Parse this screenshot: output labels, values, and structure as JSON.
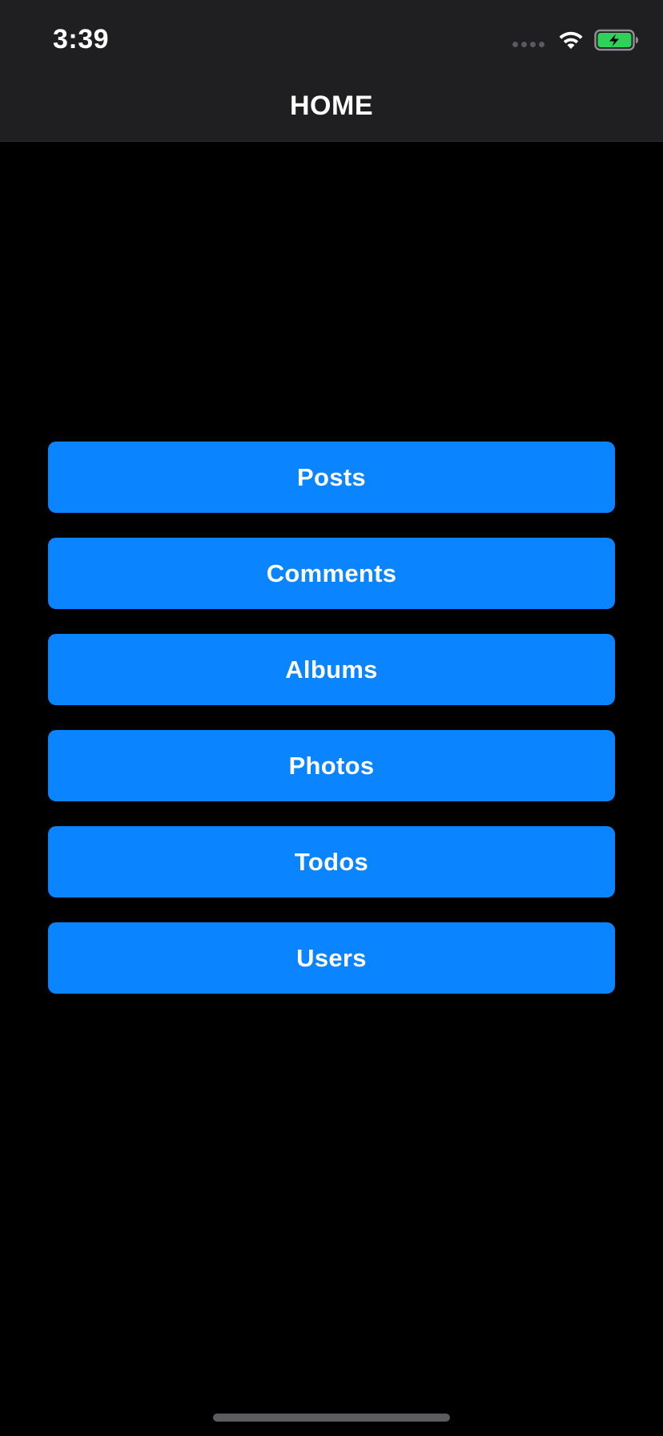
{
  "status_bar": {
    "time": "3:39",
    "icons": [
      "cellular-signal-icon",
      "wifi-icon",
      "battery-charging-icon"
    ]
  },
  "nav": {
    "title": "HOME"
  },
  "menu": {
    "buttons": [
      {
        "label": "Posts"
      },
      {
        "label": "Comments"
      },
      {
        "label": "Albums"
      },
      {
        "label": "Photos"
      },
      {
        "label": "Todos"
      },
      {
        "label": "Users"
      }
    ]
  },
  "colors": {
    "background": "#000000",
    "bar_background": "#1f1f21",
    "button_accent": "#0a84ff",
    "battery_fill": "#30d158"
  }
}
